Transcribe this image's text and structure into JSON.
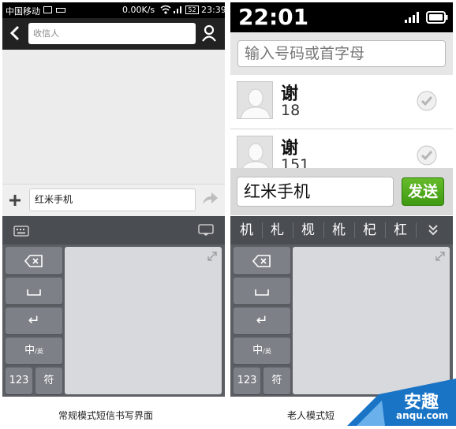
{
  "left_screen": {
    "status": {
      "carrier": "中国移动",
      "speed": "0.00K/s",
      "battery": "52",
      "time": "23:39"
    },
    "recipient_placeholder": "收信人",
    "message_text": "红米手机",
    "keyboard": {
      "enter_key": "↵",
      "lang_key_main": "中",
      "lang_key_sub": "/英",
      "num_key": "123",
      "sym_key": "符"
    },
    "caption": "常规模式短信书写界面"
  },
  "right_screen": {
    "status": {
      "time": "22:01"
    },
    "search_placeholder": "输入号码或首字母",
    "contacts": [
      {
        "name": "谢",
        "number": "18"
      },
      {
        "name": "谢",
        "number": "151"
      }
    ],
    "message_text": "红米手机",
    "send_label": "发送",
    "candidates": [
      "机",
      "札",
      "枧",
      "杹",
      "杞",
      "杠"
    ],
    "keyboard": {
      "enter_key": "↵",
      "lang_key_main": "中",
      "lang_key_sub": "/英",
      "num_key": "123",
      "sym_key": "符"
    },
    "caption": "老人模式短"
  },
  "watermark": {
    "brand": "安趣",
    "domain": "anqu.com"
  },
  "colors": {
    "send_green": "#4aa51a",
    "keyboard_dark": "#4a4d52",
    "key_gray": "#7d8086"
  }
}
